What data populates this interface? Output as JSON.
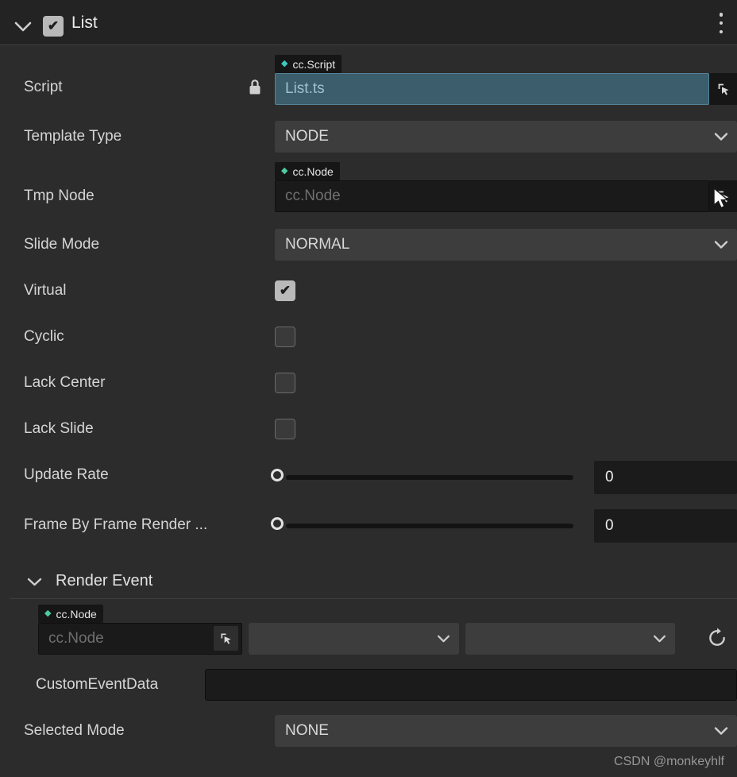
{
  "header": {
    "title": "List",
    "enabled": true
  },
  "script": {
    "label": "Script",
    "tag": "cc.Script",
    "value": "List.ts"
  },
  "template_type": {
    "label": "Template Type",
    "value": "NODE"
  },
  "tmp_node": {
    "label": "Tmp Node",
    "tag": "cc.Node",
    "placeholder": "cc.Node"
  },
  "slide_mode": {
    "label": "Slide Mode",
    "value": "NORMAL"
  },
  "checkboxes": {
    "virtual": {
      "label": "Virtual",
      "checked": true
    },
    "cyclic": {
      "label": "Cyclic",
      "checked": false
    },
    "lack_center": {
      "label": "Lack Center",
      "checked": false
    },
    "lack_slide": {
      "label": "Lack Slide",
      "checked": false
    }
  },
  "update_rate": {
    "label": "Update Rate",
    "value": "0"
  },
  "frame_by_frame": {
    "label": "Frame By Frame Render ...",
    "value": "0"
  },
  "render_event": {
    "title": "Render Event",
    "node": {
      "tag": "cc.Node",
      "placeholder": "cc.Node"
    },
    "handlers": [
      "",
      ""
    ],
    "custom_event_data": {
      "label": "CustomEventData",
      "value": ""
    }
  },
  "selected_mode": {
    "label": "Selected Mode",
    "value": "NONE"
  },
  "watermark": "CSDN @monkeyhlf",
  "colors": {
    "panel_bg": "#2c2c2c",
    "header_bg": "#232323",
    "dropdown_bg": "#3d3d3d",
    "field_bg": "#1a1a1a",
    "script_field_bg": "#3c5d6b",
    "script_field_border": "#55829a",
    "script_diamond": "#3fc6c0",
    "node_diamond": "#4ccb9e"
  }
}
